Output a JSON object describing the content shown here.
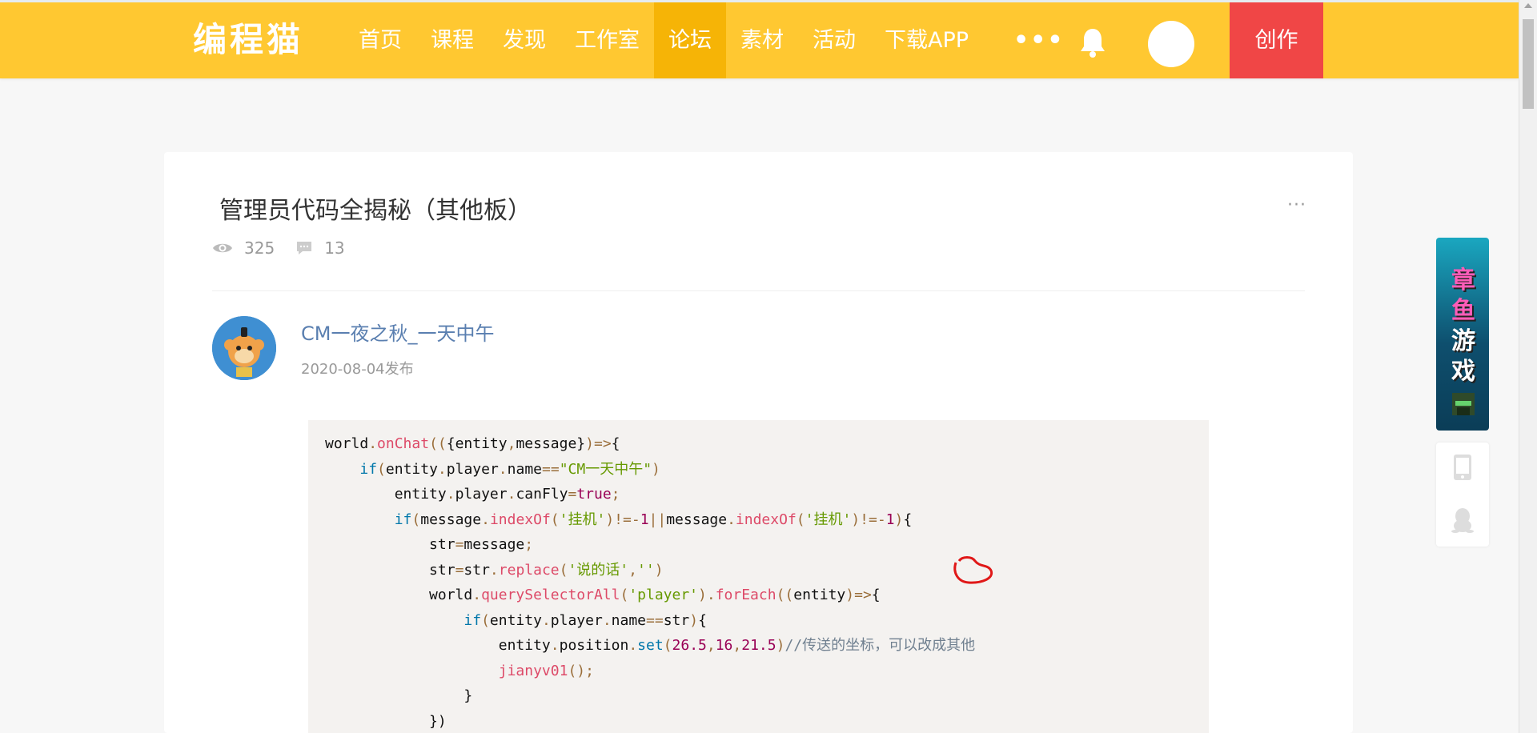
{
  "header": {
    "logo_text": "编程猫",
    "nav": [
      {
        "label": "首页",
        "active": false
      },
      {
        "label": "课程",
        "active": false
      },
      {
        "label": "发现",
        "active": false
      },
      {
        "label": "工作室",
        "active": false
      },
      {
        "label": "论坛",
        "active": true
      },
      {
        "label": "素材",
        "active": false
      },
      {
        "label": "活动",
        "active": false
      },
      {
        "label": "下载APP",
        "active": false
      }
    ],
    "more_label": "•••",
    "create_label": "创作",
    "colors": {
      "bar": "#ffc831",
      "active": "#f6b406",
      "create": "#f04646"
    }
  },
  "post": {
    "title": "管理员代码全揭秘（其他板）",
    "menu_label": "···",
    "views": "325",
    "comments": "13",
    "author": "CM一夜之秋_一天中午",
    "date": "2020-08-04发布"
  },
  "code_lines": [
    "world.onChat(({entity,message})=>{",
    "    if(entity.player.name==\"CM一天中午\")",
    "        entity.player.canFly=true;",
    "        if(message.indexOf('挂机')!=-1||message.indexOf('挂机')!=-1){",
    "            str=message;",
    "            str=str.replace('说的话','')",
    "            world.querySelectorAll('player').forEach((entity)=>{",
    "                if(entity.player.name==str){",
    "                    entity.position.set(26.5,16,21.5)//传送的坐标，可以改成其他",
    "                    jianyv01();",
    "                }",
    "            })"
  ],
  "sidebar": {
    "ad_chars": [
      "章",
      "鱼",
      "游",
      "戏"
    ],
    "tools": [
      "tablet-icon",
      "qq-penguin-icon"
    ]
  }
}
